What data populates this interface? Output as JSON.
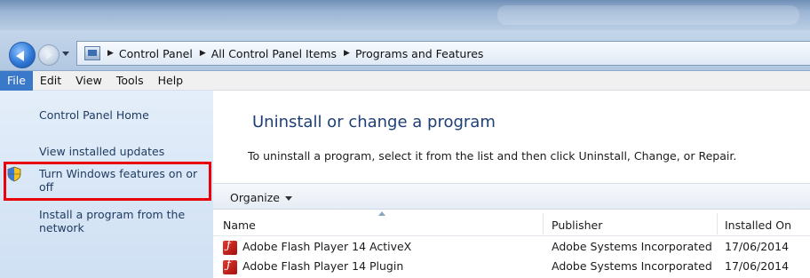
{
  "breadcrumb": {
    "items": [
      "Control Panel",
      "All Control Panel Items",
      "Programs and Features"
    ],
    "separator": "▶"
  },
  "menu": {
    "items": [
      "File",
      "Edit",
      "View",
      "Tools",
      "Help"
    ],
    "active": "File"
  },
  "sidebar": {
    "links": [
      "Control Panel Home",
      "View installed updates",
      "Turn Windows features on or off",
      "Install a program from the network"
    ]
  },
  "main": {
    "title": "Uninstall or change a program",
    "description": "To uninstall a program, select it from the list and then click Uninstall, Change, or Repair.",
    "organize_label": "Organize"
  },
  "table": {
    "columns": [
      "Name",
      "Publisher",
      "Installed On"
    ],
    "rows": [
      {
        "name": "Adobe Flash Player 14 ActiveX",
        "publisher": "Adobe Systems Incorporated",
        "installed_on": "17/06/2014",
        "icon": "flash-icon"
      },
      {
        "name": "Adobe Flash Player 14 Plugin",
        "publisher": "Adobe Systems Incorporated",
        "installed_on": "17/06/2014",
        "icon": "flash-icon"
      }
    ]
  },
  "colors": {
    "highlight": "#e8000b",
    "menu_active": "#3a79c9",
    "title": "#1e3f77"
  }
}
